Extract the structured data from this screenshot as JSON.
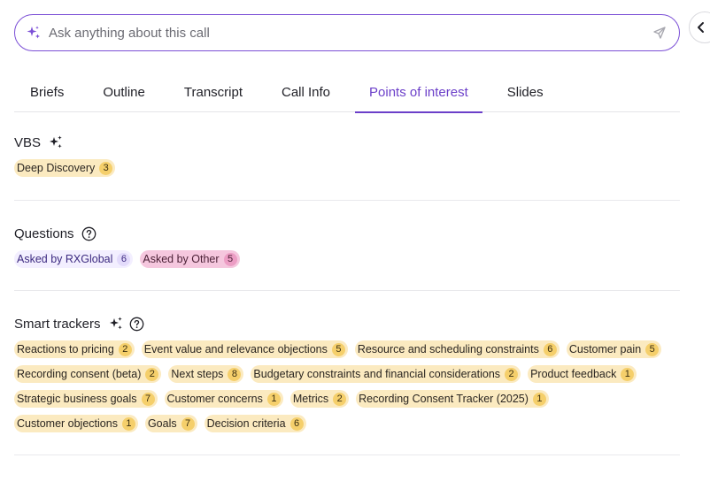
{
  "ask": {
    "placeholder": "Ask anything about this call"
  },
  "tabs": [
    {
      "label": "Briefs"
    },
    {
      "label": "Outline"
    },
    {
      "label": "Transcript"
    },
    {
      "label": "Call Info"
    },
    {
      "label": "Points of interest",
      "active": true
    },
    {
      "label": "Slides"
    }
  ],
  "vbs": {
    "title": "VBS",
    "chips": [
      {
        "label": "Deep Discovery",
        "count": "3"
      }
    ]
  },
  "questions": {
    "title": "Questions",
    "chips": [
      {
        "label": "Asked by RXGlobal",
        "count": "6"
      },
      {
        "label": "Asked by Other",
        "count": "5"
      }
    ]
  },
  "smart_trackers": {
    "title": "Smart trackers",
    "chips": [
      {
        "label": "Reactions to pricing",
        "count": "2"
      },
      {
        "label": "Event value and relevance objections",
        "count": "5"
      },
      {
        "label": "Resource and scheduling constraints",
        "count": "6"
      },
      {
        "label": "Customer pain",
        "count": "5"
      },
      {
        "label": "Recording consent (beta)",
        "count": "2"
      },
      {
        "label": "Next steps",
        "count": "8"
      },
      {
        "label": "Budgetary constraints and financial considerations",
        "count": "2"
      },
      {
        "label": "Product feedback",
        "count": "1"
      },
      {
        "label": "Strategic business goals",
        "count": "7"
      },
      {
        "label": "Customer concerns",
        "count": "1"
      },
      {
        "label": "Metrics",
        "count": "2"
      },
      {
        "label": "Recording Consent Tracker (2025)",
        "count": "1"
      },
      {
        "label": "Customer objections",
        "count": "1"
      },
      {
        "label": "Goals",
        "count": "7"
      },
      {
        "label": "Decision criteria",
        "count": "6"
      }
    ]
  },
  "colors": {
    "accent": "#6b3fc9",
    "chip_yellow": "#fbeac0",
    "chip_pink": "#f5c7de",
    "chip_lavender": "#f3efff"
  },
  "icons": {
    "ask_icon": "sparkle-icon",
    "send_icon": "send-icon",
    "collapse_icon": "chevron-left-icon",
    "ai_icon": "sparkle-icon",
    "help_icon": "help-circle-icon"
  }
}
